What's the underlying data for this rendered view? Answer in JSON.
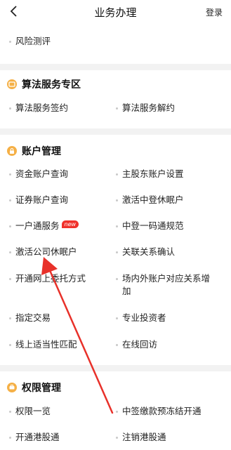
{
  "header": {
    "title": "业务办理",
    "login": "登录"
  },
  "top": {
    "item": "风险测评"
  },
  "sections": {
    "algo": {
      "title": "算法服务专区",
      "items": [
        "算法服务签约",
        "算法服务解约"
      ]
    },
    "account": {
      "title": "账户管理",
      "items": [
        "资金账户查询",
        "主股东账户设置",
        "证券账户查询",
        "激活中登休眠户",
        "一户通服务",
        "中登一码通规范",
        "激活公司休眠户",
        "关联关系确认",
        "开通网上委托方式",
        "场内外账户对应关系增加",
        "指定交易",
        "专业投资者",
        "线上适当性匹配",
        "在线回访"
      ],
      "badge": "new"
    },
    "permission": {
      "title": "权限管理",
      "items": [
        "权限一览",
        "中签缴款预冻结开通",
        "开通港股通",
        "注销港股通"
      ]
    }
  },
  "colors": {
    "accent": "#f5b046",
    "badge": "#f0312b",
    "arrow": "#e8312a",
    "divider": "#f2f2f2"
  }
}
